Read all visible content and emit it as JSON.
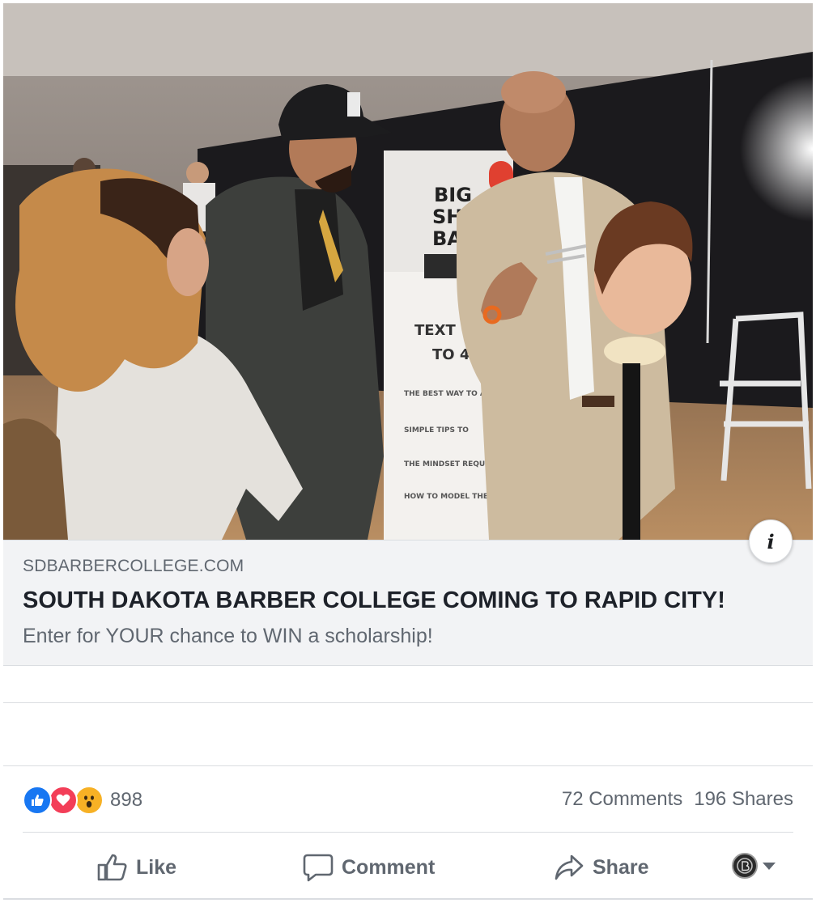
{
  "link_preview": {
    "domain": "SDBARBERCOLLEGE.COM",
    "headline": "SOUTH DAKOTA BARBER COLLEGE COMING TO RAPID CITY!",
    "description": "Enter for YOUR chance to WIN a scholarship!"
  },
  "photo": {
    "banner_lines": [
      "BIG",
      "SHOT",
      "BAR"
    ],
    "banner_text": [
      "TEXT",
      "TO 4422"
    ],
    "banner_bullets": [
      "THE BEST WAY TO AT",
      "SIMPLE TIPS TO",
      "THE MINDSET REQUI",
      "HOW TO MODEL THE BIG SHOT"
    ]
  },
  "info_button": {
    "glyph": "i"
  },
  "reactions": {
    "icons": [
      "like-icon",
      "love-icon",
      "wow-icon"
    ],
    "count": "898"
  },
  "stats": {
    "comments": "72 Comments",
    "shares": "196 Shares"
  },
  "actions": {
    "like": "Like",
    "comment": "Comment",
    "share": "Share"
  },
  "colors": {
    "like_blue": "#1877f2",
    "love_red": "#f33e58",
    "wow_yellow": "#f7b125",
    "link_bg": "#f2f3f5",
    "muted_text": "#606770"
  }
}
